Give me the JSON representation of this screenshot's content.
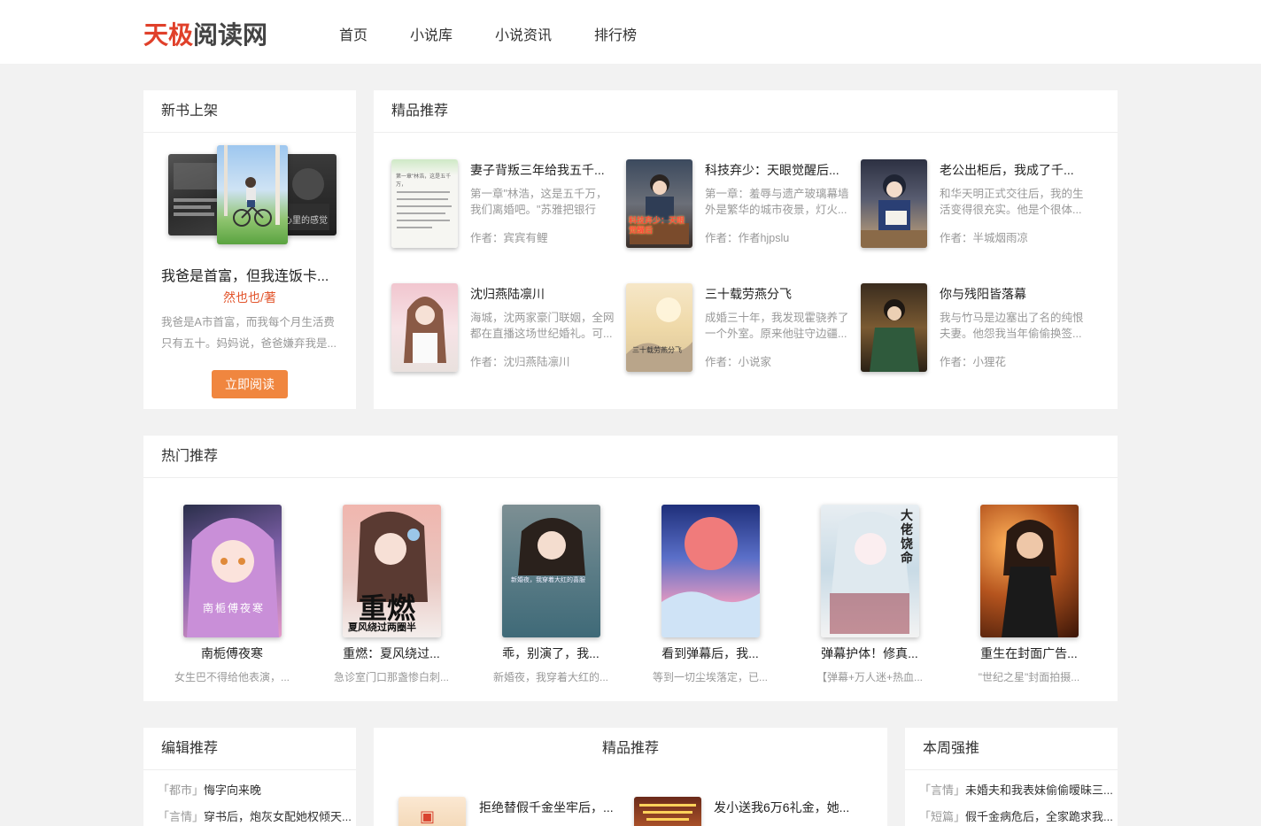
{
  "header": {
    "logo_part1": "天极",
    "logo_part2": "阅读网",
    "nav": [
      "首页",
      "小说库",
      "小说资讯",
      "排行榜"
    ]
  },
  "new_books": {
    "section_title": "新书上架",
    "book_title": "我爸是首富，但我连饭卡...",
    "author": "然也也/著",
    "desc": "我爸是A市首富，而我每个月生活费只有五十。妈妈说，爸爸嫌弃我是...",
    "read_button": "立即阅读",
    "side_cover_text": "心里的感觉"
  },
  "featured": {
    "section_title": "精品推荐",
    "author_prefix": "作者：",
    "items": [
      {
        "title": "妻子背叛三年给我五千...",
        "desc": "第一章\"林浩，这是五千万，我们离婚吧。\"苏雅把银行卡...",
        "author": "宾宾有鲤",
        "cover_text": "第一章\"林浩，这是五千万，"
      },
      {
        "title": "科技弃少：天眼觉醒后...",
        "desc": "第一章：羞辱与遗产玻璃幕墙外是繁华的城市夜景，灯火...",
        "author": "作者hjpslu",
        "cover_text": "科技弃少：天眼觉醒后"
      },
      {
        "title": "老公出柜后，我成了千...",
        "desc": "和华天明正式交往后，我的生活变得很充实。他是个很体...",
        "author": "半城烟雨凉",
        "cover_text": ""
      },
      {
        "title": "沈归燕陆凛川",
        "desc": "海城，沈两家豪门联姻，全网都在直播这场世纪婚礼。可...",
        "author": "沈归燕陆凛川",
        "cover_text": ""
      },
      {
        "title": "三十载劳燕分飞",
        "desc": "成婚三十年，我发现霍骁养了一个外室。原来他驻守边疆...",
        "author": "小说家",
        "cover_text": "三十载劳燕分飞"
      },
      {
        "title": "你与残阳皆落幕",
        "desc": "我与竹马是边塞出了名的纯恨夫妻。他怨我当年偷偷换签...",
        "author": "小狸花",
        "cover_text": ""
      }
    ]
  },
  "hot": {
    "section_title": "热门推荐",
    "items": [
      {
        "title": "南栀傅夜寒",
        "desc": "女生巴不得给他表演，...",
        "cover_text": "南栀傅夜寒"
      },
      {
        "title": "重燃：夏风绕过...",
        "desc": "急诊室门口那盏惨白刺...",
        "cover_text": "重燃",
        "cover_sub": "夏风绕过两圈半"
      },
      {
        "title": "乖，别演了，我...",
        "desc": "新婚夜，我穿着大红的...",
        "cover_text": "新婚夜，我穿着大红的喜服"
      },
      {
        "title": "看到弹幕后，我...",
        "desc": "等到一切尘埃落定，已...",
        "cover_text": ""
      },
      {
        "title": "弹幕护体！修真...",
        "desc": "【弹幕+万人迷+热血...",
        "cover_text": "大佬饶命"
      },
      {
        "title": "重生在封面广告...",
        "desc": "\"世纪之星\"封面拍摄...",
        "cover_text": ""
      }
    ]
  },
  "editor_picks": {
    "section_title": "编辑推荐",
    "items": [
      {
        "tag": "「都市」",
        "title": "悔字向来晚"
      },
      {
        "tag": "「言情」",
        "title": "穿书后，炮灰女配她权倾天..."
      }
    ]
  },
  "featured2": {
    "section_title": "精品推荐",
    "items": [
      {
        "title": "拒绝替假千金坐牢后，..."
      },
      {
        "title": "发小送我6万6礼金，她..."
      }
    ]
  },
  "weekly": {
    "section_title": "本周强推",
    "items": [
      {
        "tag": "「言情」",
        "title": "未婚夫和我表妹偷偷暧昧三..."
      },
      {
        "tag": "「短篇」",
        "title": "假千金病危后，全家跪求我..."
      }
    ]
  }
}
